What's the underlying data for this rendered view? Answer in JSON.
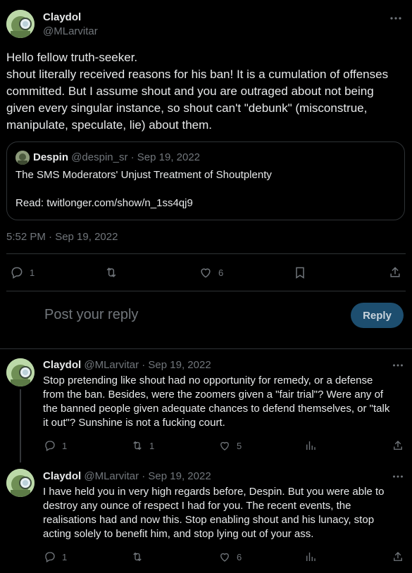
{
  "main": {
    "author_name": "Claydol",
    "author_handle": "@MLarvitar",
    "text_lines": [
      "Hello fellow truth-seeker.",
      "shout literally received reasons for his ban! It is a cumulation of offenses",
      "committed. But I assume shout and you are outraged about not being",
      "given every singular instance, so shout can't \"debunk\" (misconstrue,",
      "manipulate, speculate, lie) about them."
    ],
    "quote": {
      "name": "Despin",
      "meta": "@despin_sr · Sep 19, 2022",
      "title": "The SMS Moderators' Unjust Treatment of Shoutplenty",
      "link": "Read: twitlonger.com/show/n_1ss4qj9"
    },
    "timestamp": "5:52 PM · Sep 19, 2022",
    "actions": {
      "reply_count": "1",
      "retweet_count": "",
      "like_count": "6"
    }
  },
  "composer": {
    "placeholder": "Post your reply",
    "button_label": "Reply"
  },
  "replies": [
    {
      "name": "Claydol",
      "meta": "@MLarvitar · Sep 19, 2022",
      "lines": [
        "Stop pretending like shout had no opportunity for remedy, or a defense",
        "from the ban. Besides, were the zoomers given a \"fair trial\"? Were any of",
        "the banned people given adequate chances to defend themselves, or \"talk",
        "it out\"? Sunshine is not a fucking court."
      ],
      "reply_count": "1",
      "retweet_count": "1",
      "like_count": "5"
    },
    {
      "name": "Claydol",
      "meta": "@MLarvitar · Sep 19, 2022",
      "lines": [
        "I have held you in very high regards before, Despin. But you were able to",
        "destroy any ounce of respect I had for you. The recent events, the",
        "realisations had and now this. Stop enabling shout and his lunacy, stop",
        "acting solely to benefit him, and stop lying out of your ass."
      ],
      "reply_count": "1",
      "retweet_count": "",
      "like_count": "6"
    }
  ],
  "icons": {
    "reply": "reply-icon",
    "retweet": "retweet-icon",
    "like": "heart-icon",
    "bookmark": "bookmark-icon",
    "share": "share-icon",
    "views": "views-icon",
    "more": "more-icon"
  }
}
